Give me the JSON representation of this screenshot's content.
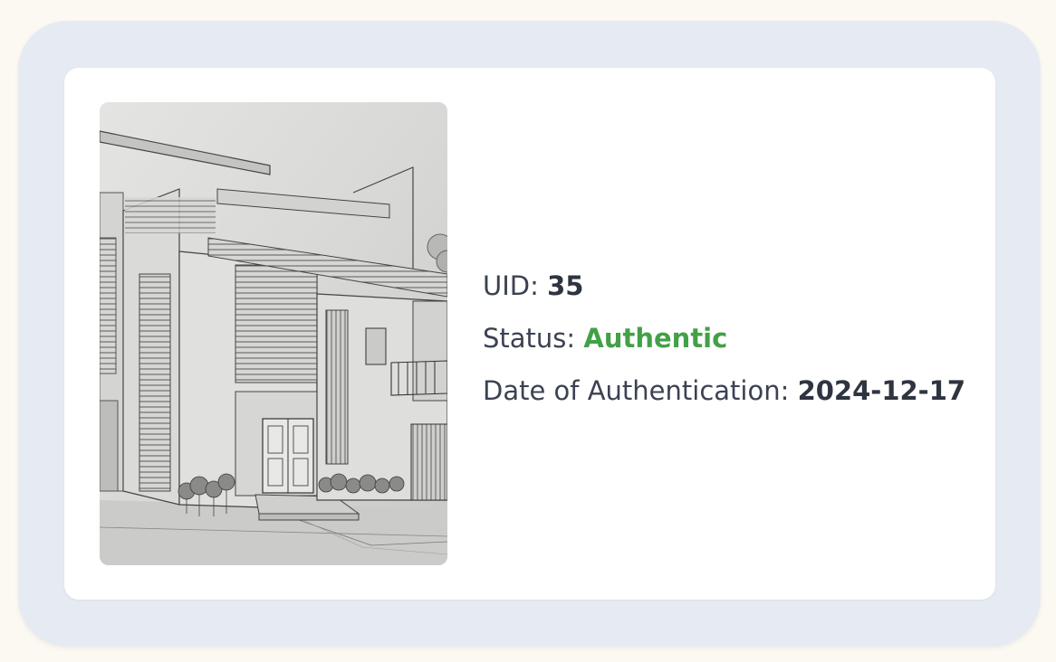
{
  "record": {
    "uid_label": "UID:",
    "uid_value": "35",
    "status_label": "Status:",
    "status_value": "Authentic",
    "date_label": "Date of Authentication:",
    "date_value": "2024-12-17"
  },
  "artwork": {
    "subject": "pencil-sketch-modern-house",
    "alt": "Pencil sketch of a modern house"
  },
  "colors": {
    "page_background": "#fcf9f2",
    "outer_panel": "#e6ebf3",
    "card": "#ffffff",
    "text": "#3b4252",
    "status_authentic": "#43a047"
  }
}
